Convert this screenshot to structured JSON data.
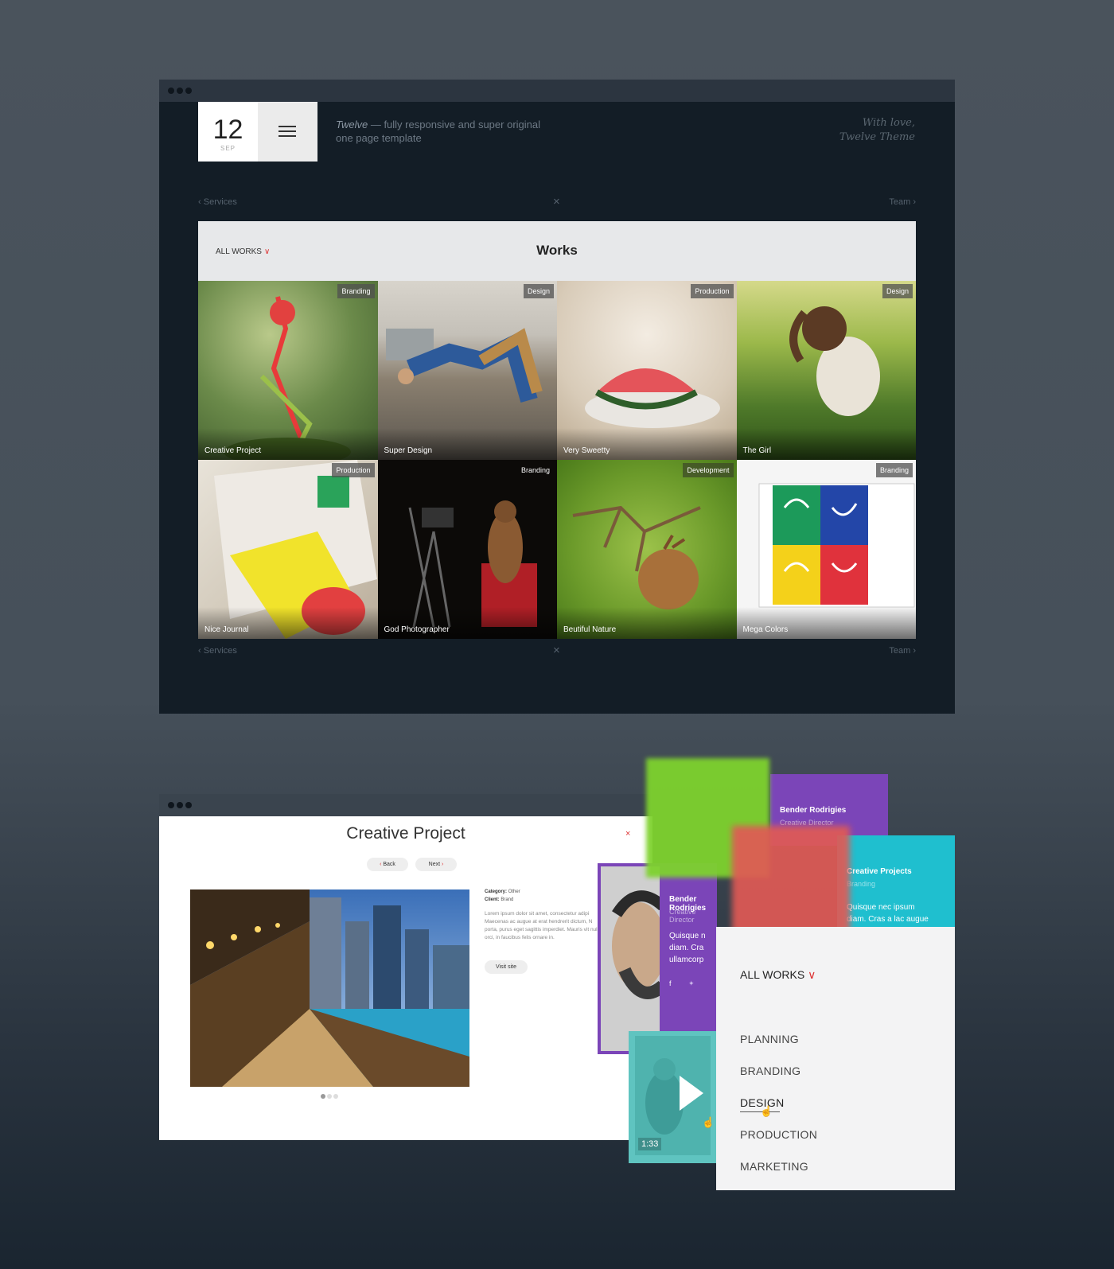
{
  "window1": {
    "date": {
      "day": "12",
      "month": "SEP"
    },
    "tagline": {
      "brand": "Twelve",
      "rest": " — fully responsive and super original one page template"
    },
    "signature": {
      "line1": "With love,",
      "line2": "Twelve Theme"
    },
    "nav_top": {
      "prev": "Services",
      "close": "×",
      "next": "Team"
    },
    "nav_bottom": {
      "prev": "Services",
      "close": "×",
      "next": "Team"
    },
    "filter_label": "ALL WORKS",
    "section_title": "Works",
    "tiles": [
      {
        "title": "Creative Project",
        "category": "Branding"
      },
      {
        "title": "Super Design",
        "category": "Design"
      },
      {
        "title": "Very Sweetty",
        "category": "Production"
      },
      {
        "title": "The Girl",
        "category": "Design"
      },
      {
        "title": "Nice Journal",
        "category": "Production"
      },
      {
        "title": "God Photographer",
        "category": "Branding"
      },
      {
        "title": "Beutiful Nature",
        "category": "Development"
      },
      {
        "title": "Mega Colors",
        "category": "Branding"
      }
    ]
  },
  "window2": {
    "title": "Creative Project",
    "close": "×",
    "back": "Back",
    "next": "Next",
    "category_label": "Category:",
    "category_value": "Other",
    "client_label": "Client:",
    "client_value": "Brand",
    "lorem": "Lorem ipsum dolor sit amet, consectetur adipi Maecenas ac augue at erat hendrerit dictum, N porta, purus eget sagittis imperdiet. Mauris vit nulla orci, in faucibus felis ornare in.",
    "visit": "Visit site",
    "slides": 3,
    "active_slide": 1
  },
  "team_card": {
    "name": "Bender Rodrigies",
    "role": "Creative Director",
    "text": "Quisque n diam. Cra ullamcorp"
  },
  "team_card_back": {
    "name": "Bender Rodrigies",
    "role": "Creative Director"
  },
  "project_card": {
    "name": "Creative Projects",
    "role": "Branding",
    "text": "Quisque nec ipsum diam. Cras a lac augue"
  },
  "video": {
    "time": "1:33"
  },
  "dropdown": {
    "label": "ALL WORKS",
    "items": [
      "PLANNING",
      "BRANDING",
      "DESIGN",
      "PRODUCTION",
      "MARKETING"
    ],
    "hovered": "DESIGN"
  },
  "colors": {
    "accent": "#dd3333",
    "purple": "#7b45b8",
    "teal": "#1fbfcf",
    "green": "#7ed22e",
    "red": "#e05a55"
  }
}
